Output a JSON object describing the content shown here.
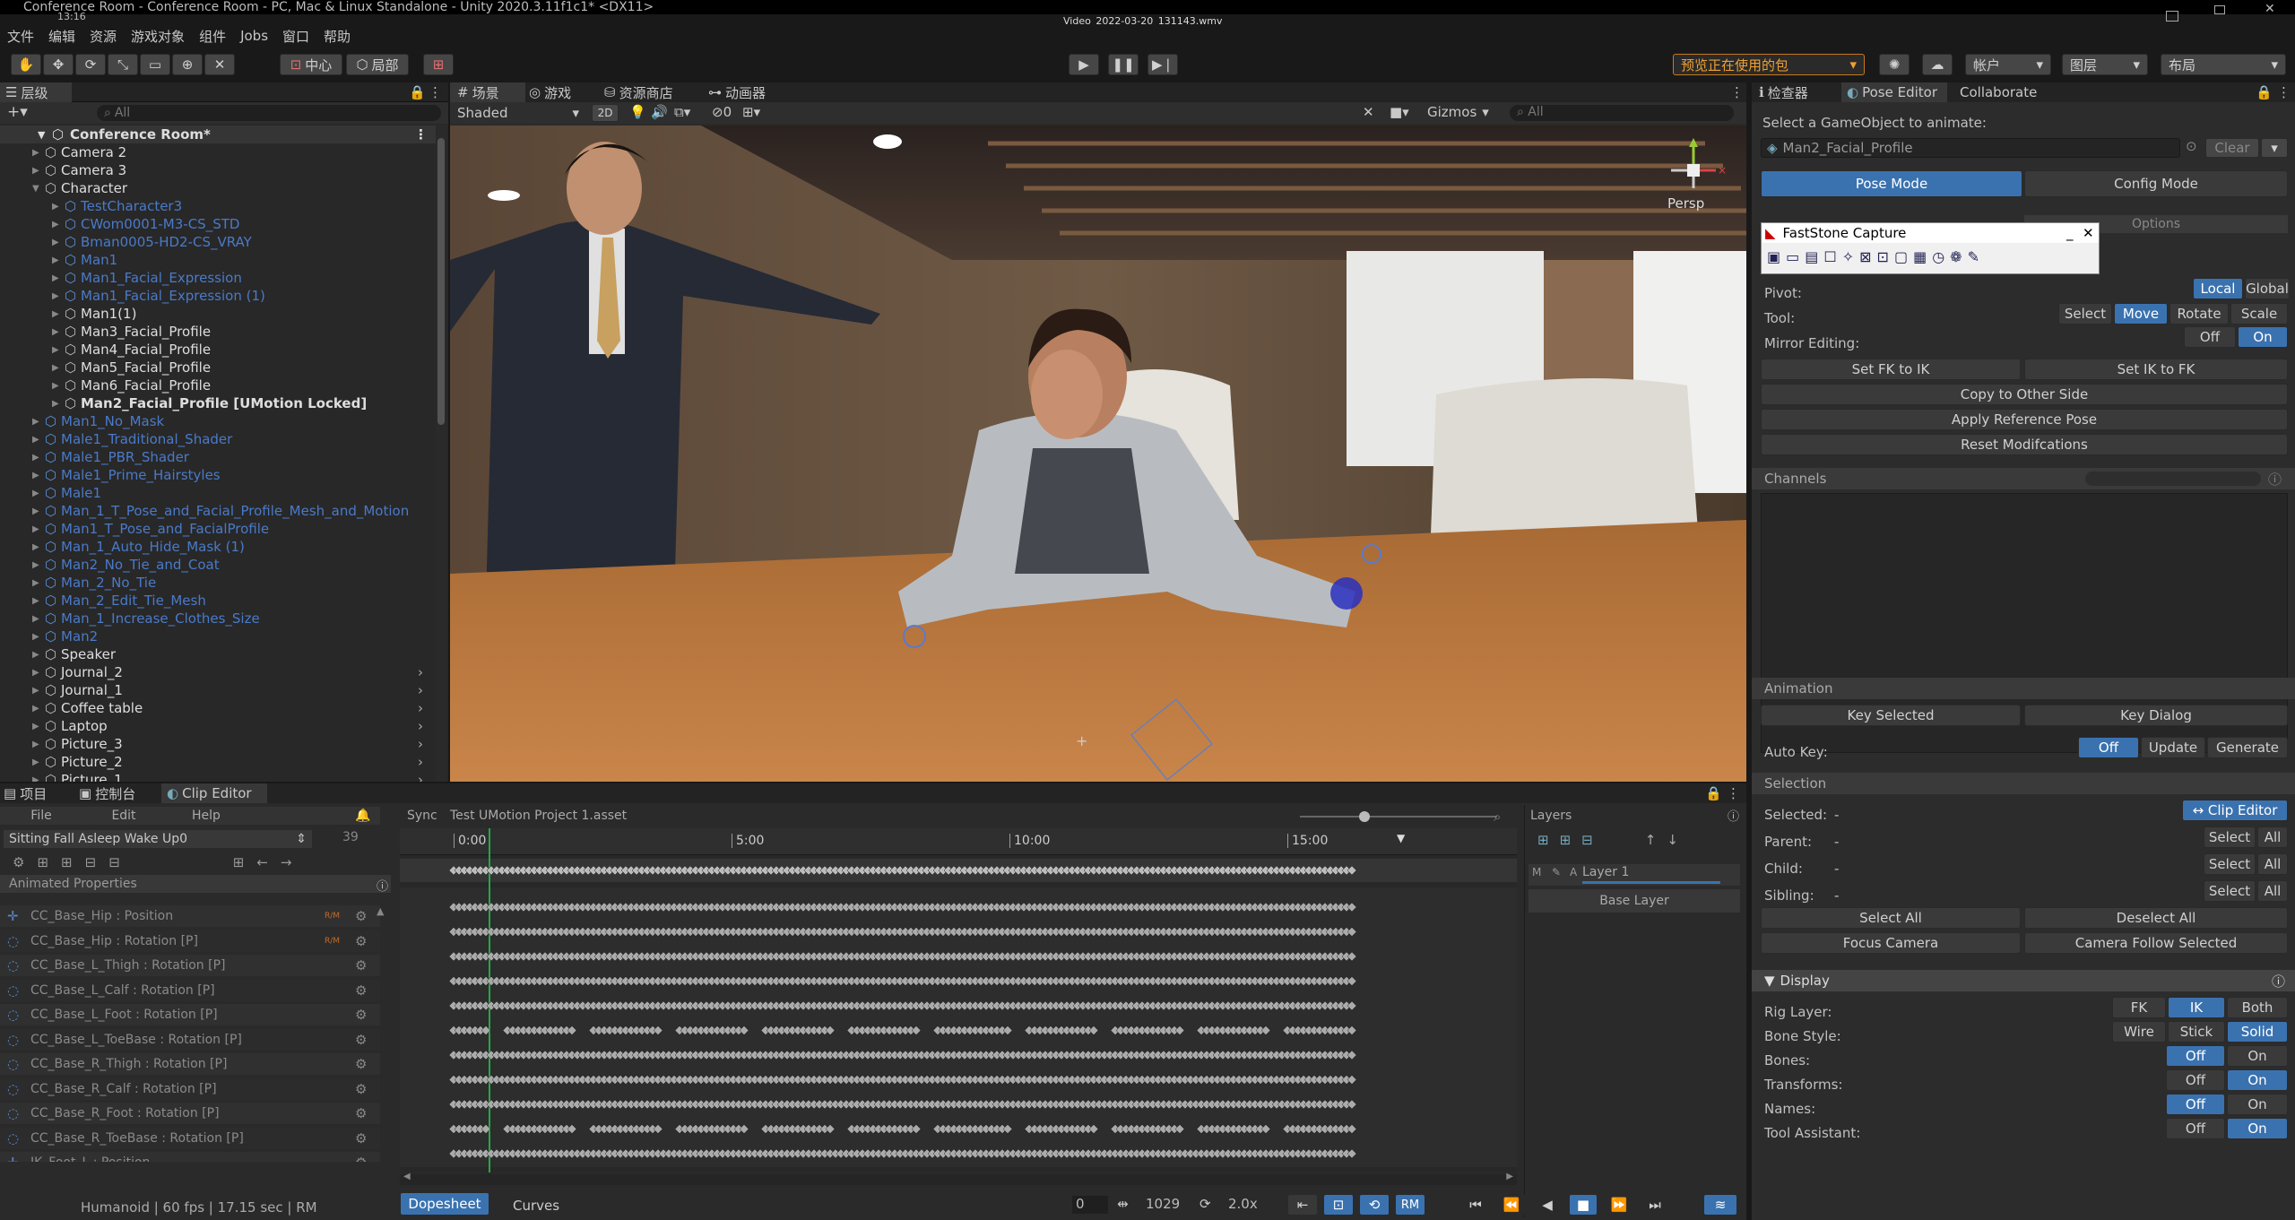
{
  "titlebar": {
    "title": "Conference Room - Conference Room - PC, Mac & Linux Standalone - Unity 2020.3.11f1c1* <DX11>",
    "clock": "13:16",
    "video": "Video_2022-03-20_131143.wmv"
  },
  "menu": [
    "文件",
    "编辑",
    "资源",
    "游戏对象",
    "组件",
    "Jobs",
    "窗口",
    "帮助"
  ],
  "toolbar": {
    "center": "中心",
    "local": "局部",
    "package_preview": "预览正在使用的包",
    "account": "帐户",
    "layers": "图层",
    "layout": "布局"
  },
  "hierarchy": {
    "tab": "层级",
    "search": "All",
    "scene": "Conference Room*",
    "items": [
      {
        "label": "Camera 2",
        "style": "white",
        "indent": 1
      },
      {
        "label": "Camera 3",
        "style": "white",
        "indent": 1
      },
      {
        "label": "Character",
        "style": "white",
        "indent": 1,
        "expanded": true
      },
      {
        "label": "TestCharacter3",
        "style": "blue",
        "indent": 2
      },
      {
        "label": "CWom0001-M3-CS_STD",
        "style": "blue",
        "indent": 2
      },
      {
        "label": "Bman0005-HD2-CS_VRAY",
        "style": "blue",
        "indent": 2
      },
      {
        "label": "Man1",
        "style": "blue",
        "indent": 2
      },
      {
        "label": "Man1_Facial_Expression",
        "style": "blue",
        "indent": 2
      },
      {
        "label": "Man1_Facial_Expression (1)",
        "style": "blue",
        "indent": 2
      },
      {
        "label": "Man1(1)",
        "style": "white",
        "indent": 2
      },
      {
        "label": "Man3_Facial_Profile",
        "style": "white",
        "indent": 2
      },
      {
        "label": "Man4_Facial_Profile",
        "style": "white",
        "indent": 2
      },
      {
        "label": "Man5_Facial_Profile",
        "style": "white",
        "indent": 2
      },
      {
        "label": "Man6_Facial_Profile",
        "style": "white",
        "indent": 2
      },
      {
        "label": "Man2_Facial_Profile [UMotion Locked]",
        "style": "bold",
        "indent": 2
      },
      {
        "label": "Man1_No_Mask",
        "style": "blue",
        "indent": 1
      },
      {
        "label": "Male1_Traditional_Shader",
        "style": "blue",
        "indent": 1
      },
      {
        "label": "Male1_PBR_Shader",
        "style": "blue",
        "indent": 1
      },
      {
        "label": "Male1_Prime_Hairstyles",
        "style": "blue",
        "indent": 1
      },
      {
        "label": "Male1",
        "style": "blue",
        "indent": 1
      },
      {
        "label": "Man_1_T_Pose_and_Facial_Profile_Mesh_and_Motion",
        "style": "blue",
        "indent": 1
      },
      {
        "label": "Man1_T_Pose_and_FacialProfile",
        "style": "blue",
        "indent": 1
      },
      {
        "label": "Man_1_Auto_Hide_Mask (1)",
        "style": "blue",
        "indent": 1
      },
      {
        "label": "Man2_No_Tie_and_Coat",
        "style": "blue",
        "indent": 1
      },
      {
        "label": "Man_2_No_Tie",
        "style": "blue",
        "indent": 1
      },
      {
        "label": "Man_2_Edit_Tie_Mesh",
        "style": "blue",
        "indent": 1
      },
      {
        "label": "Man_1_Increase_Clothes_Size",
        "style": "blue",
        "indent": 1
      },
      {
        "label": "Man2",
        "style": "blue",
        "indent": 1
      },
      {
        "label": "Speaker",
        "style": "white",
        "indent": 1
      },
      {
        "label": "Journal_2",
        "style": "white",
        "indent": 1,
        "chev": true
      },
      {
        "label": "Journal_1",
        "style": "white",
        "indent": 1,
        "chev": true
      },
      {
        "label": "Coffee table",
        "style": "white",
        "indent": 1,
        "chev": true
      },
      {
        "label": "Laptop",
        "style": "white",
        "indent": 1,
        "chev": true
      },
      {
        "label": "Picture_3",
        "style": "white",
        "indent": 1,
        "chev": true
      },
      {
        "label": "Picture_2",
        "style": "white",
        "indent": 1,
        "chev": true
      },
      {
        "label": "Picture_1",
        "style": "white",
        "indent": 1,
        "chev": true
      }
    ]
  },
  "scene_tabs": [
    "场景",
    "游戏",
    "资源商店",
    "动画器"
  ],
  "scene_toolbar": {
    "shading": "Shaded",
    "mode2d": "2D",
    "gizmos": "Gizmos",
    "search": "All",
    "persp": "Persp",
    "fx_count": "0"
  },
  "bottom_tabs": [
    "项目",
    "控制台",
    "Clip Editor"
  ],
  "clip_editor": {
    "menu": [
      "File",
      "Edit",
      "Help"
    ],
    "sync": "Sync",
    "project": "Test UMotion Project 1.asset",
    "clip": "Sitting Fall Asleep Wake Up0",
    "frame": "39",
    "ruler": [
      "0:00",
      "5:00",
      "10:00",
      "15:00"
    ],
    "animated_header": "Animated Properties",
    "properties": [
      {
        "label": "CC_Base_Hip : Position",
        "tag": "R/M",
        "type": "pos"
      },
      {
        "label": "CC_Base_Hip : Rotation [P]",
        "tag": "R/M",
        "type": "rot"
      },
      {
        "label": "CC_Base_L_Thigh : Rotation [P]",
        "type": "rot"
      },
      {
        "label": "CC_Base_L_Calf : Rotation [P]",
        "type": "rot"
      },
      {
        "label": "CC_Base_L_Foot : Rotation [P]",
        "type": "rot"
      },
      {
        "label": "CC_Base_L_ToeBase : Rotation [P]",
        "type": "rot"
      },
      {
        "label": "CC_Base_R_Thigh : Rotation [P]",
        "type": "rot"
      },
      {
        "label": "CC_Base_R_Calf : Rotation [P]",
        "type": "rot"
      },
      {
        "label": "CC_Base_R_Foot : Rotation [P]",
        "type": "rot"
      },
      {
        "label": "CC_Base_R_ToeBase : Rotation [P]",
        "type": "rot"
      },
      {
        "label": "IK_Foot_L : Position",
        "type": "pos"
      }
    ],
    "status": "Humanoid | 60 fps | 17.15 sec | RM",
    "view_tabs": [
      "Dopesheet",
      "Curves"
    ],
    "start_frame": "0",
    "end_frame": "1029",
    "speed": "2.0x",
    "rm": "RM",
    "layers_title": "Layers",
    "layer1": "Layer 1",
    "base_layer": "Base Layer"
  },
  "right_tabs": [
    "检查器",
    "Pose Editor",
    "Collaborate"
  ],
  "pose_editor": {
    "select_label": "Select a GameObject to animate:",
    "target": "Man2_Facial_Profile",
    "clear": "Clear",
    "pose_mode": "Pose Mode",
    "config_mode": "Config Mode",
    "options": "Options",
    "pivot": "Pivot:",
    "local": "Local",
    "global": "Global",
    "tool": "Tool:",
    "select": "Select",
    "move": "Move",
    "rotate": "Rotate",
    "scale": "Scale",
    "mirror": "Mirror Editing:",
    "off": "Off",
    "on": "On",
    "fk_to_ik": "Set FK to IK",
    "ik_to_fk": "Set IK to FK",
    "copy_other": "Copy to Other Side",
    "apply_ref": "Apply Reference Pose",
    "reset_mod": "Reset Modifcations",
    "channels": "Channels",
    "animation": "Animation",
    "key_selected": "Key Selected",
    "key_dialog": "Key Dialog",
    "auto_key": "Auto Key:",
    "update": "Update",
    "generate": "Generate",
    "selection": "Selection",
    "selected": "Selected:",
    "clip_editor_btn": "↔ Clip Editor",
    "parent": "Parent:",
    "child": "Child:",
    "sibling": "Sibling:",
    "all": "All",
    "dash": "-",
    "select_all": "Select All",
    "deselect_all": "Deselect All",
    "focus_camera": "Focus Camera",
    "camera_follow": "Camera Follow Selected",
    "display": "Display",
    "rig_layer": "Rig Layer:",
    "fk": "FK",
    "ik": "IK",
    "both": "Both",
    "bone_style": "Bone Style:",
    "wire": "Wire",
    "stick": "Stick",
    "solid": "Solid",
    "bones": "Bones:",
    "transforms": "Transforms:",
    "names": "Names:",
    "tool_assistant": "Tool Assistant:"
  },
  "faststone": {
    "title": "FastStone Capture"
  }
}
